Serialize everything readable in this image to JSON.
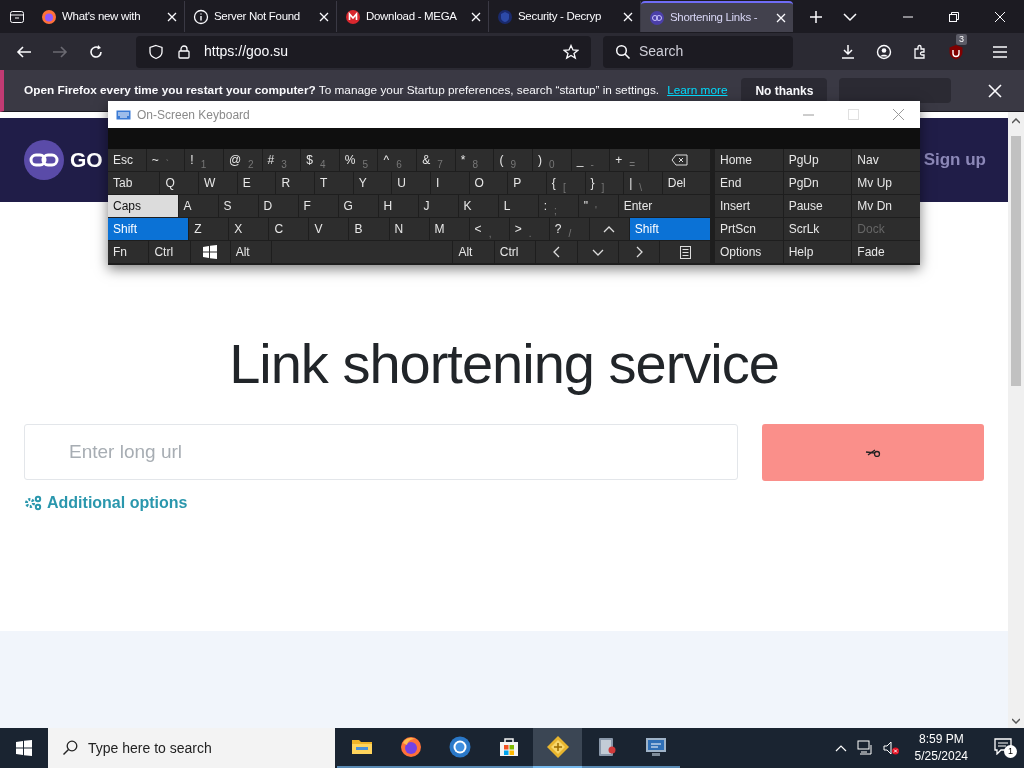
{
  "browser": {
    "tabs": [
      {
        "title": "What's new with",
        "selected": false
      },
      {
        "title": "Server Not Found",
        "selected": false
      },
      {
        "title": "Download - MEGA",
        "selected": false
      },
      {
        "title": "Security - Decryp",
        "selected": false
      },
      {
        "title": "Shortening Links -",
        "selected": true
      }
    ],
    "url": "https://goo.su",
    "search": {
      "placeholder": "Search"
    },
    "addon_badge": "3"
  },
  "notification": {
    "text": "**Open Firefox every time you restart your computer?** To manage your Startup preferences, search “startup” in settings.",
    "link": "Learn more",
    "button": "No thanks"
  },
  "page": {
    "logo_text": "GO",
    "sign_up": "Sign up",
    "heading": "Link shortening service",
    "url_field": {
      "placeholder": "Enter long url"
    },
    "options_link": "Additional options"
  },
  "keyboard": {
    "title": "On-Screen Keyboard",
    "rows": [
      {
        "keys": [
          {
            "kind": "key",
            "label": "Esc",
            "on": false,
            "hover": false
          },
          {
            "kind": "char",
            "label": "~",
            "sub": "`",
            "on": false,
            "hover": false
          },
          {
            "kind": "char",
            "label": "!",
            "sub": "1",
            "on": false,
            "hover": false
          },
          {
            "kind": "char",
            "label": "@",
            "sub": "2",
            "on": false,
            "hover": false
          },
          {
            "kind": "char",
            "label": "#",
            "sub": "3",
            "on": false,
            "hover": false
          },
          {
            "kind": "char",
            "label": "$",
            "sub": "4",
            "on": false,
            "hover": false
          },
          {
            "kind": "char",
            "label": "%",
            "sub": "5",
            "on": false,
            "hover": false
          },
          {
            "kind": "char",
            "label": "^",
            "sub": "6",
            "on": false,
            "hover": false
          },
          {
            "kind": "char",
            "label": "&",
            "sub": "7",
            "on": false,
            "hover": false
          },
          {
            "kind": "char",
            "label": "*",
            "sub": "8",
            "on": false,
            "hover": false
          },
          {
            "kind": "char",
            "label": "(",
            "sub": "9",
            "on": false,
            "hover": false
          },
          {
            "kind": "char",
            "label": ")",
            "sub": "0",
            "on": false,
            "hover": false
          },
          {
            "kind": "char",
            "label": "_",
            "sub": "-",
            "on": false,
            "hover": false
          },
          {
            "kind": "char",
            "label": "+",
            "sub": "=",
            "on": false,
            "hover": false
          },
          {
            "kind": "backspace",
            "on": false,
            "hover": false
          }
        ]
      },
      {
        "keys": [
          {
            "kind": "tab",
            "label": "Tab",
            "on": false,
            "hover": false
          },
          {
            "kind": "char",
            "label": "Q",
            "on": false,
            "hover": false
          },
          {
            "kind": "char",
            "label": "W",
            "on": false,
            "hover": false
          },
          {
            "kind": "char",
            "label": "E",
            "on": false,
            "hover": false
          },
          {
            "kind": "char",
            "label": "R",
            "on": false,
            "hover": false
          },
          {
            "kind": "char",
            "label": "T",
            "on": false,
            "hover": false
          },
          {
            "kind": "char",
            "label": "Y",
            "on": false,
            "hover": false
          },
          {
            "kind": "char",
            "label": "U",
            "on": false,
            "hover": false
          },
          {
            "kind": "char",
            "label": "I",
            "on": false,
            "hover": false
          },
          {
            "kind": "char",
            "label": "O",
            "on": false,
            "hover": false
          },
          {
            "kind": "char",
            "label": "P",
            "on": false,
            "hover": false
          },
          {
            "kind": "char",
            "label": "{",
            "sub": "[",
            "on": false,
            "hover": false
          },
          {
            "kind": "char",
            "label": "}",
            "sub": "]",
            "on": false,
            "hover": false
          },
          {
            "kind": "char",
            "label": "|",
            "sub": "\\",
            "on": false,
            "hover": false
          },
          {
            "kind": "delete",
            "label": "Del",
            "on": false,
            "hover": false
          }
        ]
      },
      {
        "keys": [
          {
            "kind": "caps",
            "label": "Caps",
            "on": false,
            "hover": true
          },
          {
            "kind": "char",
            "label": "A",
            "on": false,
            "hover": false
          },
          {
            "kind": "char",
            "label": "S",
            "on": false,
            "hover": false
          },
          {
            "kind": "char",
            "label": "D",
            "on": false,
            "hover": false
          },
          {
            "kind": "char",
            "label": "F",
            "on": false,
            "hover": false
          },
          {
            "kind": "char",
            "label": "G",
            "on": false,
            "hover": false
          },
          {
            "kind": "char",
            "label": "H",
            "on": false,
            "hover": false
          },
          {
            "kind": "char",
            "label": "J",
            "on": false,
            "hover": false
          },
          {
            "kind": "char",
            "label": "K",
            "on": false,
            "hover": false
          },
          {
            "kind": "char",
            "label": "L",
            "on": false,
            "hover": false
          },
          {
            "kind": "char",
            "label": ":",
            "sub": ";",
            "on": false,
            "hover": false
          },
          {
            "kind": "char",
            "label": "\"",
            "sub": "'",
            "on": false,
            "hover": false
          },
          {
            "kind": "enter",
            "label": "Enter",
            "on": false,
            "hover": false
          }
        ]
      },
      {
        "keys": [
          {
            "kind": "shift",
            "label": "Shift",
            "on": true,
            "hover": false
          },
          {
            "kind": "char",
            "label": "Z",
            "on": false,
            "hover": false
          },
          {
            "kind": "char",
            "label": "X",
            "on": false,
            "hover": false
          },
          {
            "kind": "char",
            "label": "C",
            "on": false,
            "hover": false
          },
          {
            "kind": "char",
            "label": "V",
            "on": false,
            "hover": false
          },
          {
            "kind": "char",
            "label": "B",
            "on": false,
            "hover": false
          },
          {
            "kind": "char",
            "label": "N",
            "on": false,
            "hover": false
          },
          {
            "kind": "char",
            "label": "M",
            "on": false,
            "hover": false
          },
          {
            "kind": "char",
            "label": "<",
            "sub": ",",
            "on": false,
            "hover": false
          },
          {
            "kind": "char",
            "label": ">",
            "sub": ".",
            "on": false,
            "hover": false
          },
          {
            "kind": "char",
            "label": "?",
            "sub": "/",
            "on": false,
            "hover": false
          },
          {
            "kind": "up",
            "on": false,
            "hover": false
          },
          {
            "kind": "shift",
            "label": "Shift",
            "on": true,
            "hover": false
          }
        ]
      },
      {
        "keys": [
          {
            "kind": "key",
            "label": "Fn",
            "on": false,
            "hover": false
          },
          {
            "kind": "key",
            "label": "Ctrl",
            "on": false,
            "hover": false
          },
          {
            "kind": "windows",
            "on": false,
            "hover": false
          },
          {
            "kind": "key",
            "label": "Alt",
            "on": false,
            "hover": false
          },
          {
            "kind": "space",
            "on": false,
            "hover": false
          },
          {
            "kind": "key",
            "label": "Alt",
            "on": false,
            "hover": false
          },
          {
            "kind": "key",
            "label": "Ctrl",
            "on": false,
            "hover": false
          },
          {
            "kind": "left",
            "on": false,
            "hover": false
          },
          {
            "kind": "down",
            "on": false,
            "hover": false
          },
          {
            "kind": "right",
            "on": false,
            "hover": false
          },
          {
            "kind": "menu",
            "on": false,
            "hover": false
          }
        ]
      }
    ],
    "side_rows": [
      {
        "keys": [
          {
            "label": "Home",
            "disabled": false
          },
          {
            "label": "PgUp",
            "disabled": false
          },
          {
            "label": "Nav",
            "disabled": false
          }
        ]
      },
      {
        "keys": [
          {
            "label": "End",
            "disabled": false
          },
          {
            "label": "PgDn",
            "disabled": false
          },
          {
            "label": "Mv Up",
            "disabled": false
          }
        ]
      },
      {
        "keys": [
          {
            "label": "Insert",
            "disabled": false
          },
          {
            "label": "Pause",
            "disabled": false
          },
          {
            "label": "Mv Dn",
            "disabled": false
          }
        ]
      },
      {
        "keys": [
          {
            "label": "PrtScn",
            "disabled": false
          },
          {
            "label": "ScrLk",
            "disabled": false
          },
          {
            "label": "Dock",
            "disabled": true
          }
        ]
      },
      {
        "keys": [
          {
            "label": "Options",
            "disabled": false
          },
          {
            "label": "Help",
            "disabled": false
          },
          {
            "label": "Fade",
            "disabled": false
          }
        ]
      }
    ]
  },
  "taskbar": {
    "search": {
      "placeholder": "Type here to search"
    },
    "time": "8:59 PM",
    "date": "5/25/2024",
    "notification_count": "1",
    "apps": [
      {
        "active": false
      },
      {
        "active": false
      },
      {
        "active": false
      },
      {
        "active": false
      },
      {
        "active": true
      },
      {
        "active": false
      },
      {
        "active": false
      }
    ]
  }
}
